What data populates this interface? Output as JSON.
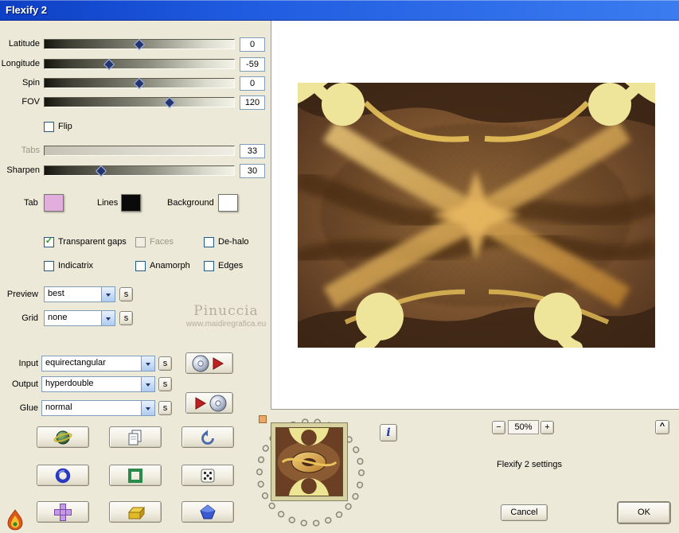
{
  "titlebar": {
    "title": "Flexify 2"
  },
  "sliders": [
    {
      "label": "Latitude",
      "value": "0",
      "pos": "50%",
      "disabled": false
    },
    {
      "label": "Longitude",
      "value": "-59",
      "pos": "34%",
      "disabled": false
    },
    {
      "label": "Spin",
      "value": "0",
      "pos": "50%",
      "disabled": false
    },
    {
      "label": "FOV",
      "value": "120",
      "pos": "66%",
      "disabled": false
    },
    {
      "label": "Tabs",
      "value": "33",
      "pos": "33%",
      "disabled": true
    },
    {
      "label": "Sharpen",
      "value": "30",
      "pos": "30%",
      "disabled": false
    }
  ],
  "flip": {
    "label": "Flip",
    "checked": false
  },
  "swatches": [
    {
      "label": "Tab",
      "color": "#e2aede"
    },
    {
      "label": "Lines",
      "color": "#0a0a0a"
    },
    {
      "label": "Background",
      "color": "#ffffff"
    }
  ],
  "checkboxes": [
    {
      "label": "Transparent gaps",
      "checked": true,
      "mark": "✓",
      "disabled": false
    },
    {
      "label": "Faces",
      "checked": false,
      "mark": "",
      "disabled": true
    },
    {
      "label": "De-halo",
      "checked": false,
      "mark": "",
      "disabled": false
    },
    {
      "label": "Indicatrix",
      "checked": false,
      "mark": "",
      "disabled": false
    },
    {
      "label": "Anamorph",
      "checked": false,
      "mark": "",
      "disabled": false
    },
    {
      "label": "Edges",
      "checked": false,
      "mark": "",
      "disabled": false
    }
  ],
  "combos": [
    {
      "label": "Preview",
      "value": "best"
    },
    {
      "label": "Grid",
      "value": "none"
    },
    {
      "label": "Input",
      "value": "equirectangular"
    },
    {
      "label": "Output",
      "value": "hyperdouble"
    },
    {
      "label": "Glue",
      "value": "normal"
    }
  ],
  "s_button": {
    "label": "s"
  },
  "watermark": {
    "line1": "Pinuccia",
    "line2": "www.maidiregrafica.eu"
  },
  "zoom": {
    "minus": "−",
    "value": "50%",
    "plus": "+"
  },
  "panel": {
    "collapse": "^"
  },
  "info": {
    "label": "i"
  },
  "status": {
    "text": "Flexify 2 settings"
  },
  "actions": {
    "cancel": "Cancel",
    "ok": "OK"
  }
}
